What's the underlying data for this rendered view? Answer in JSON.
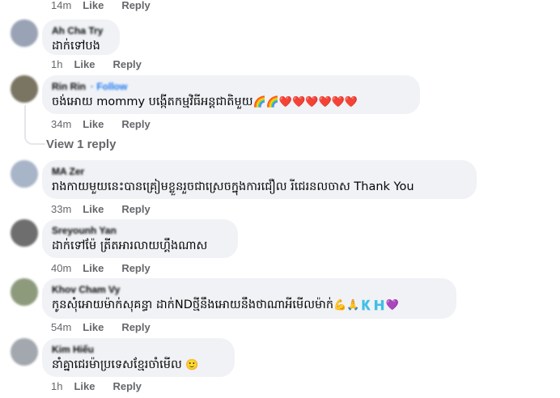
{
  "top_actions": {
    "time": "14m",
    "like": "Like",
    "reply": "Reply"
  },
  "comments": [
    {
      "name": "Ah Cha Try",
      "text": "ដាក់ទៅបង",
      "time": "1h",
      "like": "Like",
      "reply": "Reply",
      "avatar_color": "#9aa3b5"
    },
    {
      "name": "Rin Rin",
      "follow": "· Follow",
      "text": "ចង់អោយ mommy បង្កើតកម្មវិធីអន្តជាតិមួយ",
      "emoji": "🌈🌈❤️❤️❤️❤️❤️❤️",
      "time": "34m",
      "like": "Like",
      "reply": "Reply",
      "avatar_color": "#7a7462"
    },
    {
      "name": "MA Zer",
      "text": "រាងកាយមួយនេះបានគ្រៀមខ្លួនរួចជាស្រេចក្នុងការជឿល រីជេរនលចាស Thank You",
      "time": "33m",
      "like": "Like",
      "reply": "Reply",
      "avatar_color": "#a8b4c8"
    },
    {
      "name": "Sreyounh Yan",
      "text": "ដាក់ទៅម៉ែ ត្រីតអារលាយហ្គឹងណាស",
      "time": "40m",
      "like": "Like",
      "reply": "Reply",
      "avatar_color": "#6e6e6e"
    },
    {
      "name": "Khov Cham Vy",
      "text": "កូនសុំអោយម៉ាក់សុគន្ធា ដាក់NDថ្មីនឹងអោយនឹងថាណាអីមើលម៉ាក់",
      "emoji": "💪🙏🇰🇭💜",
      "time": "54m",
      "like": "Like",
      "reply": "Reply",
      "avatar_color": "#8e9a7c"
    },
    {
      "name": "Kim Hiếu",
      "text": "នាំគ្នាជេរម៉ាប្រទេសខ្មែរចាំមើល",
      "emoji": "🙂",
      "time": "1h",
      "like": "Like",
      "reply": "Reply",
      "avatar_color": "#a3a7ae"
    }
  ],
  "view_replies": "View 1 reply"
}
